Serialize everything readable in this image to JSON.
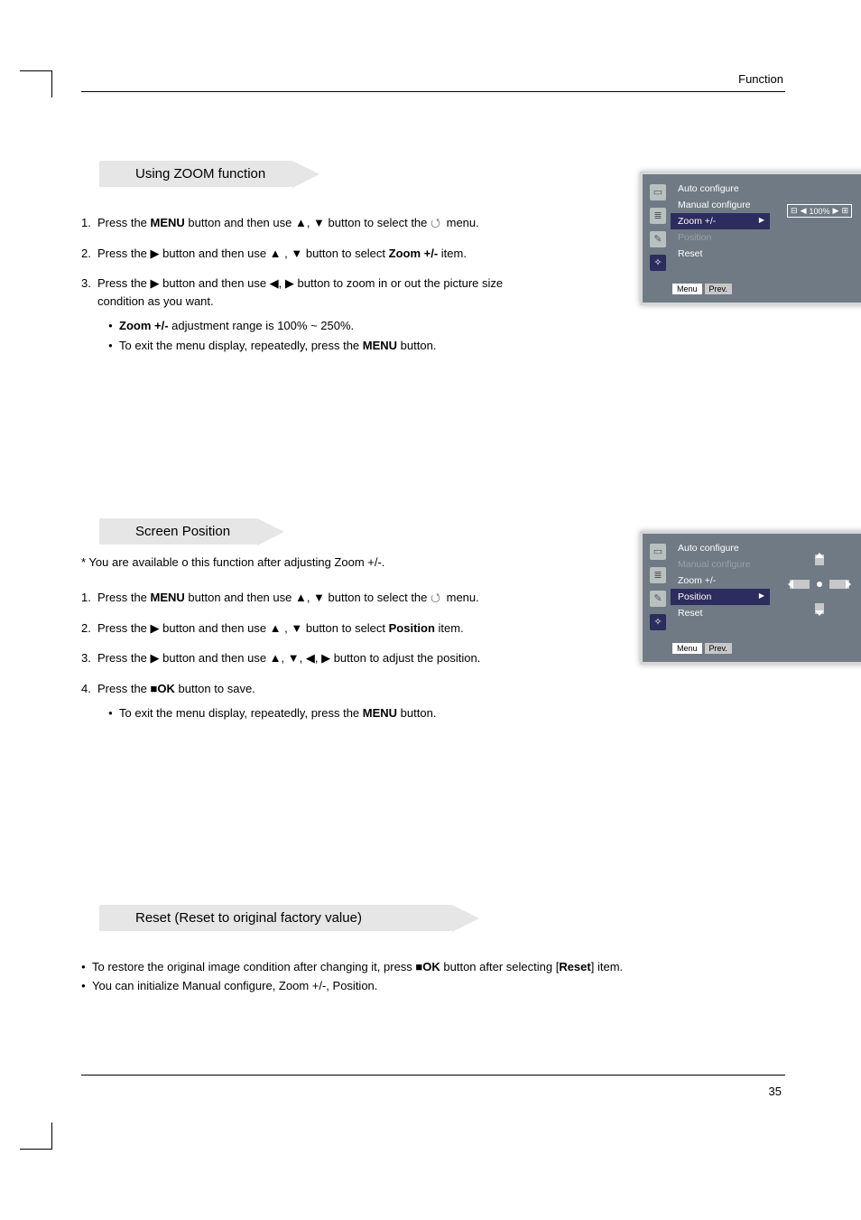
{
  "header": {
    "section": "Function"
  },
  "page_number": "35",
  "sections": {
    "zoom": {
      "title": "Using ZOOM function",
      "steps": [
        {
          "n": "1.",
          "pre": "Press the ",
          "b1": "MENU",
          "post1": " button and then use ▲, ▼ button to select the ",
          "icon": true,
          "post2": " menu."
        },
        {
          "n": "2.",
          "pre": "Press the ▶ button and then use ▲ , ▼ button to select ",
          "b1": "Zoom +/-",
          "post1": " item."
        },
        {
          "n": "3.",
          "pre": "Press the ▶ button and then use ◀, ▶ button to zoom in or out the picture size condition as you want."
        }
      ],
      "bullets": [
        {
          "b": "Zoom +/-",
          "rest": " adjustment range is 100% ~ 250%."
        },
        {
          "plain": "To exit the menu display, repeatedly, press the ",
          "b": "MENU",
          "rest": " button."
        }
      ]
    },
    "position": {
      "title": "Screen Position",
      "note": "* You are available o this function after adjusting Zoom +/-.",
      "steps": [
        {
          "n": "1.",
          "pre": "Press the ",
          "b1": "MENU",
          "post1": " button and then use ▲, ▼ button to select the ",
          "icon": true,
          "post2": " menu."
        },
        {
          "n": "2.",
          "pre": "Press the ▶ button and then use ▲ , ▼ button to select ",
          "b1": "Position",
          "post1": " item."
        },
        {
          "n": "3.",
          "pre": "Press the ▶ button and then use ▲, ▼, ◀, ▶ button to adjust the position."
        },
        {
          "n": "4.",
          "pre": "Press the ■",
          "b1": "OK",
          "post1": " button to save."
        }
      ],
      "bullets": [
        {
          "plain": "To exit the menu display, repeatedly, press the ",
          "b": "MENU",
          "rest": " button."
        }
      ]
    },
    "reset": {
      "title": "Reset (Reset to original factory value)",
      "bullets": [
        {
          "plain": "To restore the original image condition after changing it, press ■",
          "b": "OK",
          "mid": " button after selecting [",
          "b2": "Reset",
          "rest": "] item."
        },
        {
          "plain": "You can initialize Manual configure, Zoom +/-, Position."
        }
      ]
    }
  },
  "osd": {
    "items": [
      "Auto configure",
      "Manual configure",
      "Zoom +/-",
      "Position",
      "Reset"
    ],
    "zoom_value": "100%",
    "footer_menu": "Menu",
    "footer_prev": "Prev."
  }
}
